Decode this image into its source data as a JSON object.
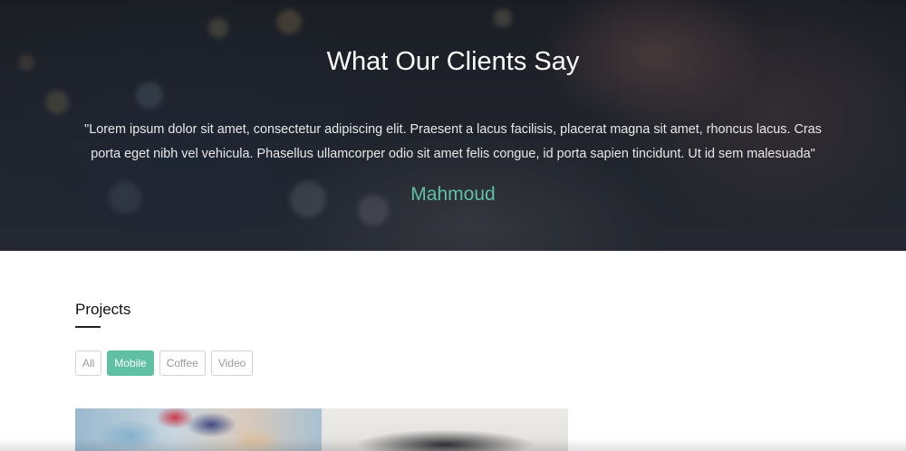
{
  "testimonial": {
    "title": "What Our Clients Say",
    "quote": "\"Lorem ipsum dolor sit amet, consectetur adipiscing elit. Praesent a lacus facilisis, placerat magna sit amet, rhoncus lacus. Cras porta eget nibh vel vehicula. Phasellus ullamcorper odio sit amet felis congue, id porta sapien tincidunt. Ut id sem malesuada\"",
    "author": "Mahmoud"
  },
  "projects": {
    "title": "Projects",
    "filters": [
      {
        "label": "All",
        "active": false
      },
      {
        "label": "Mobile",
        "active": true
      },
      {
        "label": "Coffee",
        "active": false
      },
      {
        "label": "Video",
        "active": false
      }
    ]
  },
  "colors": {
    "accent": "#5fc0a3",
    "filter_border": "#d4d4d4",
    "filter_text": "#9a9a9a"
  }
}
